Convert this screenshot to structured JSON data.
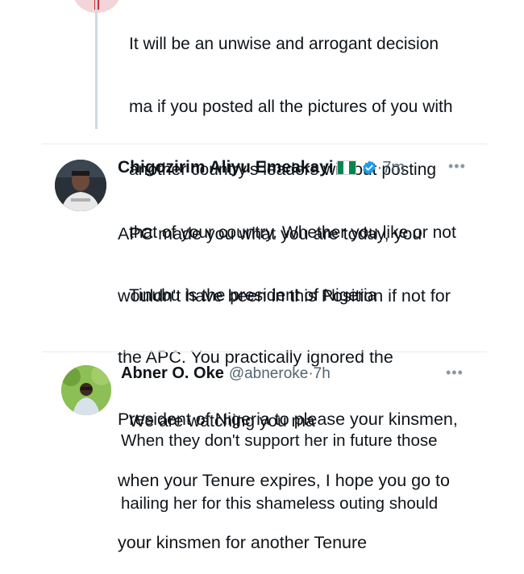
{
  "tweets": [
    {
      "text_lines": [
        "It will be an unwise and arrogant decision",
        "ma if you posted all the pictures of you with",
        "another country's leaders without posting",
        "that of your country. Whether you like or not",
        "Tinubu is the president of Nigeria"
      ],
      "closing": "We are watching you ma"
    },
    {
      "name": "Chigozirim Aliyu Emeakayi",
      "time": "7m",
      "text_lines": [
        "APC made you what you are today, you",
        "wouldn't have been in this Position if not for",
        "the APC. You practically ignored the",
        "President of Nigeria to please your kinsmen,",
        "when your Tenure expires, I hope you go to",
        "your kinsmen for another Tenure"
      ]
    },
    {
      "name": "Abner O. Oke",
      "handle": "@abneroke",
      "time": "7h",
      "text_lines": [
        "When they don't support her in future those",
        "hailing her for this shameless outing should"
      ]
    }
  ],
  "icons": {
    "more": "more-icon",
    "verified": "verified-badge-icon",
    "flag": "nigeria-flag-icon"
  },
  "colors": {
    "text": "#0f1419",
    "secondary": "#536471",
    "verified": "#1d9bf0",
    "flag_green": "#008751",
    "separator": "#e6ecf0"
  }
}
